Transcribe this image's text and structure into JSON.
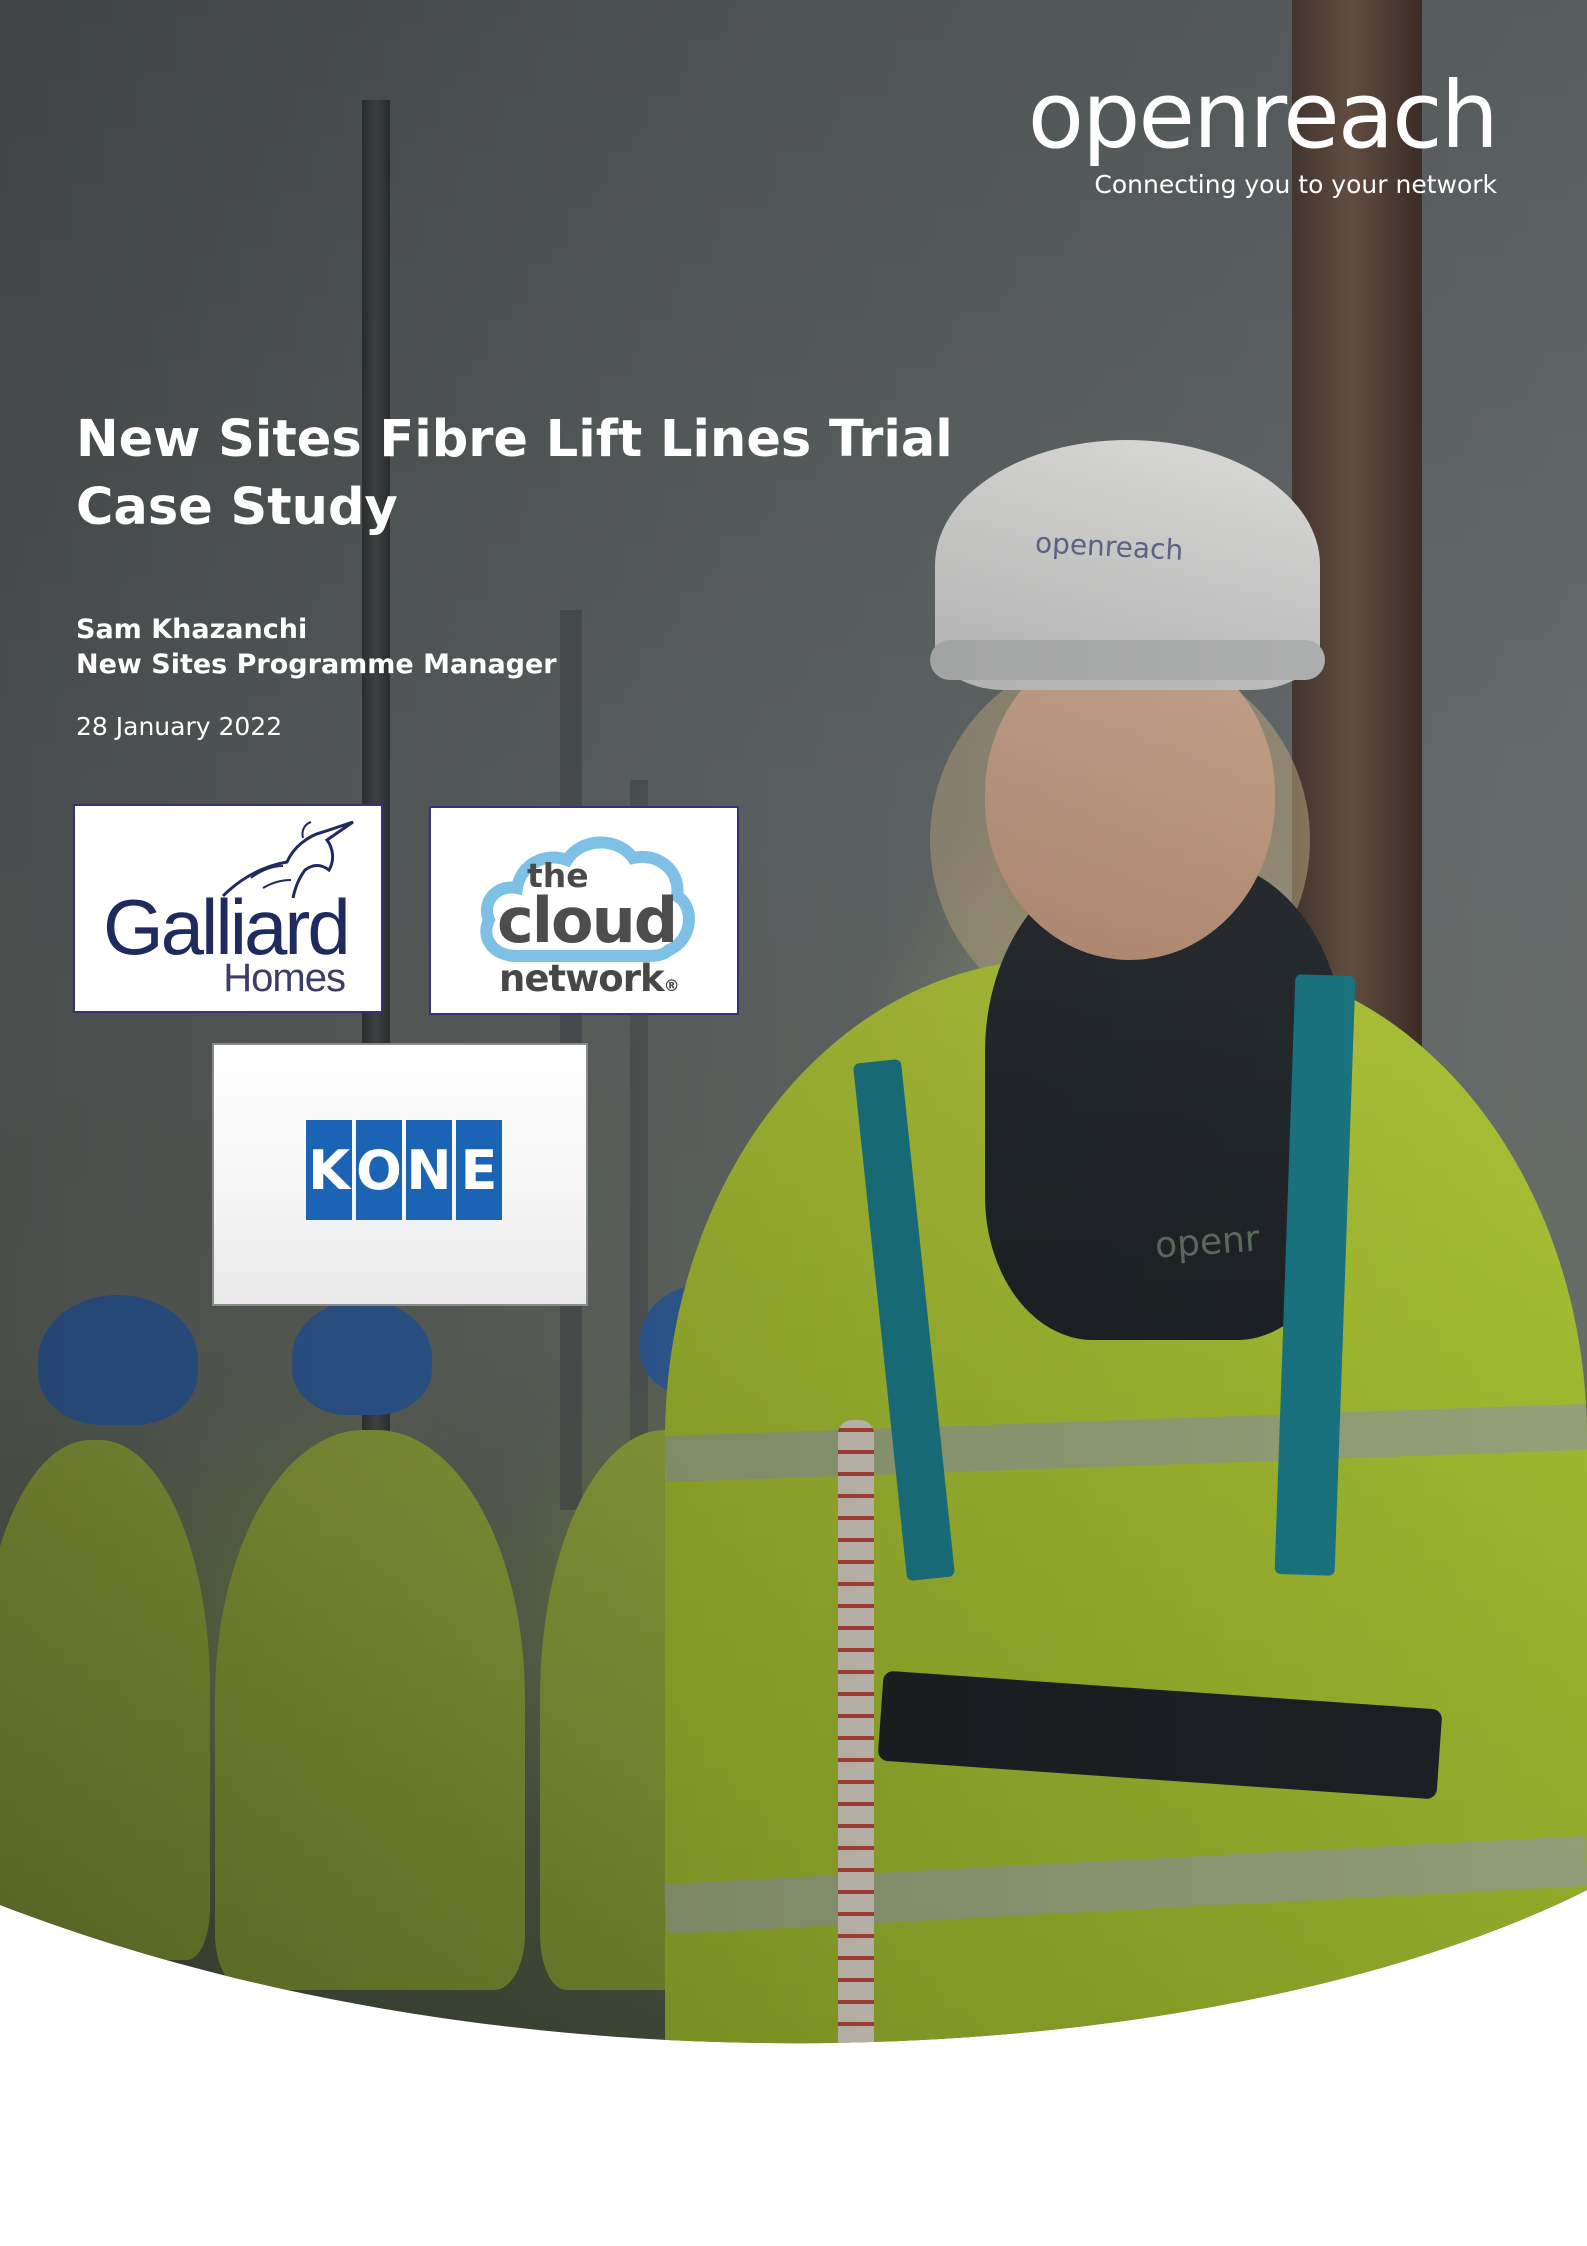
{
  "brand": {
    "name": "openreach",
    "tagline": "Connecting you to your network"
  },
  "document": {
    "title": "New Sites Fibre Lift Lines Trial",
    "subtitle": "Case Study",
    "author_name": "Sam Khazanchi",
    "author_role": "New Sites Programme Manager",
    "date": "28 January 2022"
  },
  "photo": {
    "helmet_text": "openreach",
    "vest_text": "openr"
  },
  "partners": {
    "galliard": {
      "name": "Galliard",
      "sub": "Homes",
      "color": "#1f2a5e"
    },
    "cloud": {
      "the": "the",
      "cloud": "cloud",
      "network": "network",
      "reg": "®",
      "color": "#7fc1e6"
    },
    "kone": {
      "letters": [
        "K",
        "O",
        "N",
        "E"
      ],
      "color": "#1a63b5"
    }
  }
}
